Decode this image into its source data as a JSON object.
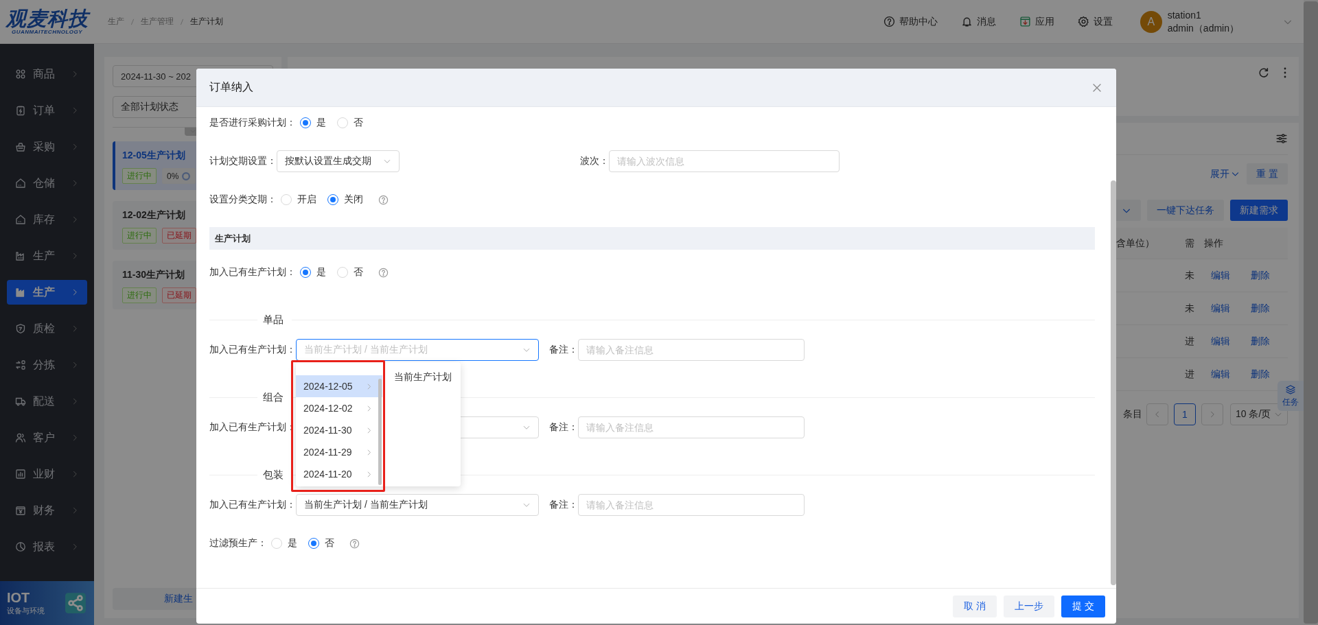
{
  "logo": {
    "title": "观麦科技",
    "subtitle": "GUANMAITECHNOLOGY"
  },
  "breadcrumb": [
    "生产",
    "生产管理",
    "生产计划"
  ],
  "header_actions": [
    {
      "label": "帮助中心"
    },
    {
      "label": "消息"
    },
    {
      "label": "应用"
    },
    {
      "label": "设置"
    }
  ],
  "user": {
    "avatar": "A",
    "station": "station1",
    "name": "admin（admin）"
  },
  "sidebar": {
    "items": [
      {
        "label": "商品",
        "selected": false
      },
      {
        "label": "订单",
        "selected": false
      },
      {
        "label": "采购",
        "selected": false
      },
      {
        "label": "仓储",
        "selected": false
      },
      {
        "label": "库存",
        "selected": false
      },
      {
        "label": "生产",
        "selected": false
      },
      {
        "label": "生产",
        "selected": true
      },
      {
        "label": "质检",
        "selected": false
      },
      {
        "label": "分拣",
        "selected": false
      },
      {
        "label": "配送",
        "selected": false
      },
      {
        "label": "客户",
        "selected": false
      },
      {
        "label": "业财",
        "selected": false
      },
      {
        "label": "财务",
        "selected": false
      },
      {
        "label": "报表",
        "selected": false
      }
    ]
  },
  "iot_banner": {
    "title": "IOT",
    "subtitle": "设备与环境"
  },
  "plan_list": {
    "date_range": "2024-11-30 ~ 202",
    "status_filter": "全部计划状态",
    "plans": [
      {
        "title": "12-05生产计划",
        "selected": true,
        "tags": [
          {
            "kind": "status",
            "label": "进行中"
          },
          {
            "kind": "progress",
            "label": "0%"
          }
        ]
      },
      {
        "title": "12-02生产计划",
        "selected": false,
        "tags": [
          {
            "kind": "status",
            "label": "进行中"
          },
          {
            "kind": "delay",
            "label": "已延期"
          }
        ]
      },
      {
        "title": "11-30生产计划",
        "selected": false,
        "tags": [
          {
            "kind": "status",
            "label": "进行中"
          },
          {
            "kind": "delay",
            "label": "已延期"
          }
        ]
      }
    ],
    "new_button": "新建生"
  },
  "detail": {
    "expand_link": "展开",
    "reset_button": "重 置",
    "batch_button": "一键下达任务",
    "new_button": "新建需求",
    "table": {
      "columns": [
        "含单位）",
        "需",
        "操作"
      ],
      "rows": [
        {
          "column_2": "未",
          "actions": [
            "编辑",
            "删除"
          ]
        },
        {
          "column_2": "未",
          "actions": [
            "编辑",
            "删除"
          ]
        },
        {
          "column_2": "进",
          "actions": [
            "编辑",
            "删除"
          ]
        },
        {
          "column_2": "进",
          "actions": [
            "编辑",
            "删除"
          ]
        }
      ]
    },
    "pagination": {
      "total_text": "条目",
      "pages": [
        {
          "label": "1",
          "selected": true
        }
      ],
      "page_size": "10 条/页"
    },
    "task_button": "任务"
  },
  "modal": {
    "title": "订单纳入",
    "rows": [
      {
        "kind": "radio",
        "label": "是否进行采购计划：",
        "options": [
          {
            "label": "是",
            "selected": true
          },
          {
            "label": "否",
            "selected": false
          }
        ],
        "help": false
      },
      {
        "kind": "select",
        "label": "计划交期设置：",
        "value": "按默认设置生成交期",
        "extra_label": "波次：",
        "extra_placeholder": "请输入波次信息"
      },
      {
        "kind": "radio",
        "label": "设置分类交期：",
        "options": [
          {
            "label": "开启",
            "selected": false
          },
          {
            "label": "关闭",
            "selected": true
          }
        ],
        "help": true
      },
      {
        "kind": "section",
        "title": "生产计划"
      },
      {
        "kind": "radio",
        "label": "加入已有生产计划：",
        "options": [
          {
            "label": "是",
            "selected": true
          },
          {
            "label": "否",
            "selected": false
          }
        ],
        "help": true
      },
      {
        "kind": "divider",
        "title": "单品"
      },
      {
        "kind": "cascader",
        "label": "加入已有生产计划：",
        "placeholder": "当前生产计划 / 当前生产计划",
        "focused": true,
        "note_label": "备注：",
        "note_placeholder": "请输入备注信息"
      },
      {
        "kind": "divider",
        "title": "组合"
      },
      {
        "kind": "cascader",
        "label": "加入已有生产计划：",
        "focused": false,
        "note_label": "备注：",
        "note_placeholder": "请输入备注信息"
      },
      {
        "kind": "divider",
        "title": "包装"
      },
      {
        "kind": "cascader",
        "label": "加入已有生产计划：",
        "value": "当前生产计划 / 当前生产计划",
        "focused": false,
        "note_label": "备注：",
        "note_placeholder": "请输入备注信息"
      },
      {
        "kind": "radio",
        "label": "过滤预生产：",
        "options": [
          {
            "label": "是",
            "selected": false
          },
          {
            "label": "否",
            "selected": true
          }
        ],
        "help": true
      }
    ],
    "cascader_menu": {
      "dates": [
        {
          "label": "2024-12-05",
          "selected": true
        },
        {
          "label": "2024-12-02",
          "selected": false
        },
        {
          "label": "2024-11-30",
          "selected": false
        },
        {
          "label": "2024-11-29",
          "selected": false
        },
        {
          "label": "2024-11-20",
          "selected": false
        }
      ],
      "plans": [
        "当前生产计划"
      ]
    },
    "footer": [
      {
        "label": "取 消",
        "kind": "plain"
      },
      {
        "label": "上一步",
        "kind": "plain"
      },
      {
        "label": "提 交",
        "kind": "primary"
      }
    ]
  }
}
